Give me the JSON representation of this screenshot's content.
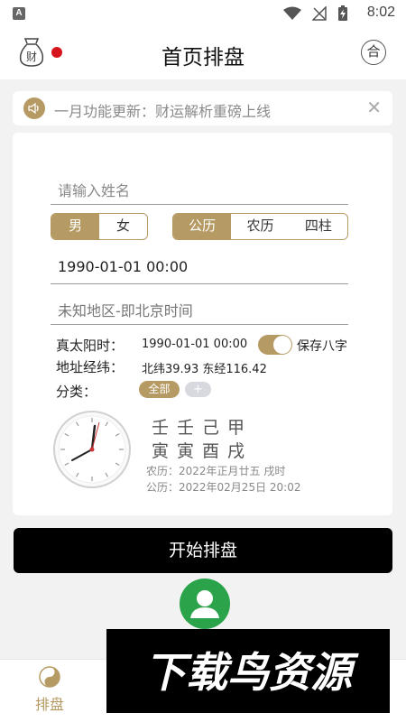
{
  "status_bar": {
    "time": "8:02",
    "app_icon_letter": "A",
    "icons": [
      "wifi-icon",
      "signal-off-icon",
      "battery-charging-icon"
    ]
  },
  "header": {
    "title": "首页排盘",
    "left_icon": "money-bag-icon",
    "left_icon_char": "财",
    "right_button": "合"
  },
  "notice": {
    "text": "一月功能更新：财运解析重磅上线",
    "icon": "speaker-icon",
    "close_symbol": "✕"
  },
  "form": {
    "name_placeholder": "请输入姓名",
    "gender_options": [
      "男",
      "女"
    ],
    "gender_selected": "男",
    "calendar_options": [
      "公历",
      "农历",
      "四柱"
    ],
    "calendar_selected": "公历",
    "datetime_value": "1990-01-01 00:00",
    "region_value": "未知地区-即北京时间",
    "true_solar_label": "真太阳时：",
    "true_solar_value": "1990-01-01 00:00",
    "save_bazi_label": "保存八字",
    "save_bazi_on": true,
    "location_label": "地址经纬：",
    "location_value": "北纬39.93 东经116.42",
    "category_label": "分类：",
    "category_tag": "全部",
    "category_add": "+"
  },
  "bazi": {
    "stems": "壬壬己甲",
    "branches": "寅寅酉戌",
    "lunar": "农历：2022年正月廿五 戌时",
    "solar": "公历：2022年02月25日 20:02"
  },
  "start_button": "开始排盘",
  "bottom_nav": {
    "tab_label": "排盘",
    "tab_icon": "yin-yang-icon"
  },
  "watermark": {
    "text": "下载鸟资源"
  },
  "colors": {
    "accent": "#b59a63",
    "dot": "#d6141c",
    "avatar_bg": "#2aa34a"
  }
}
